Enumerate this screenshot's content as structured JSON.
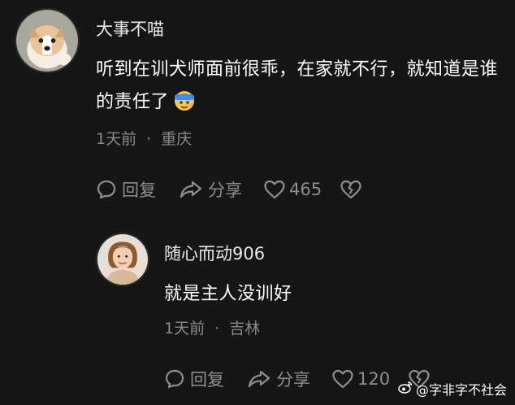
{
  "colors": {
    "background": "#161616",
    "text": "#ffffff",
    "muted": "#8a8a8a"
  },
  "comments": [
    {
      "username": "大事不喵",
      "text": "听到在训犬师面前很乖，在家就不行，就知道是谁的责任了",
      "emoji_icon": "face-with-bandage-emoji-icon",
      "time": "1天前",
      "separator": "·",
      "location": "重庆",
      "reply_label": "回复",
      "share_label": "分享",
      "like_count": "465"
    },
    {
      "username": "随心而动906",
      "text": "就是主人没训好",
      "time": "1天前",
      "separator": "·",
      "location": "吉林",
      "reply_label": "回复",
      "share_label": "分享",
      "like_count": "120"
    }
  ],
  "watermark": {
    "text": "@字非字不社会",
    "icon": "weibo-logo-icon"
  }
}
